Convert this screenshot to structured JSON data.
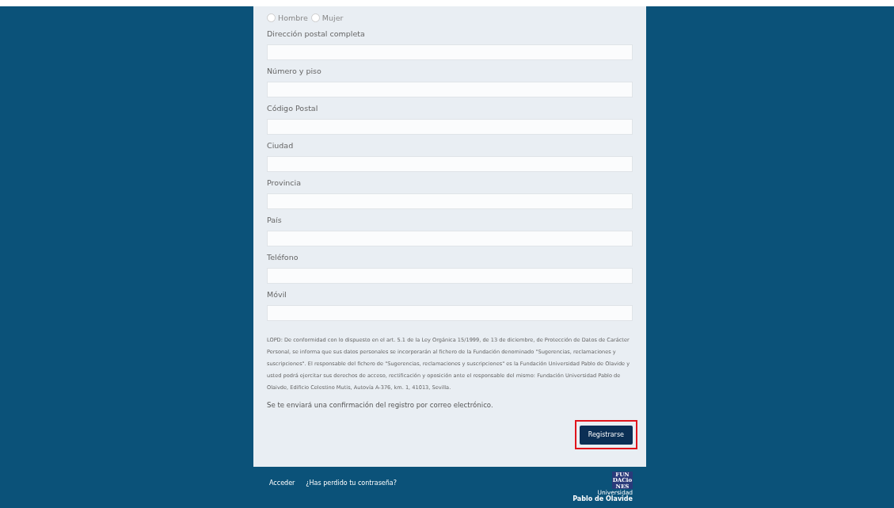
{
  "gender": {
    "options": [
      {
        "label": "Hombre",
        "selected": false
      },
      {
        "label": "Mujer",
        "selected": false
      }
    ]
  },
  "fields": [
    {
      "label": "Dirección postal completa"
    },
    {
      "label": "Número y piso"
    },
    {
      "label": "Código Postal"
    },
    {
      "label": "Ciudad"
    },
    {
      "label": "Provincia"
    },
    {
      "label": "País"
    },
    {
      "label": "Teléfono"
    },
    {
      "label": "Móvil"
    }
  ],
  "legal_text": "LOPD: De conformidad con lo dispuesto en el art. 5.1 de la Ley Orgánica 15/1999, de 13 de diciembre, de Protección de Datos de Carácter Personal, se informa que sus datos personales se incorporarán al fichero de la Fundación denominado \"Sugerencias, reclamaciones y suscripciones\". El responsable del fichero de \"Sugerencias, reclamaciones y suscripciones\" es la Fundación Universidad Pablo de Olavide y usted podrá ejercitar sus derechos de acceso, rectificación y oposición ante el responsable del mismo: Fundación Universidad Pablo de Olaivde, Edificio Celestino Mutis, Autovía A-376, km. 1, 41013, Sevilla.",
  "confirmation_note": "Se te enviará una confirmación del registro por correo electrónico.",
  "submit_button": "Registrarse",
  "footer": {
    "links": [
      "Acceder",
      "¿Has perdido tu contraseña?"
    ],
    "logo_lines": [
      "FUN",
      "DACio",
      "NES"
    ],
    "logo_caption": [
      "Universidad",
      "Pablo de Olavide"
    ]
  }
}
